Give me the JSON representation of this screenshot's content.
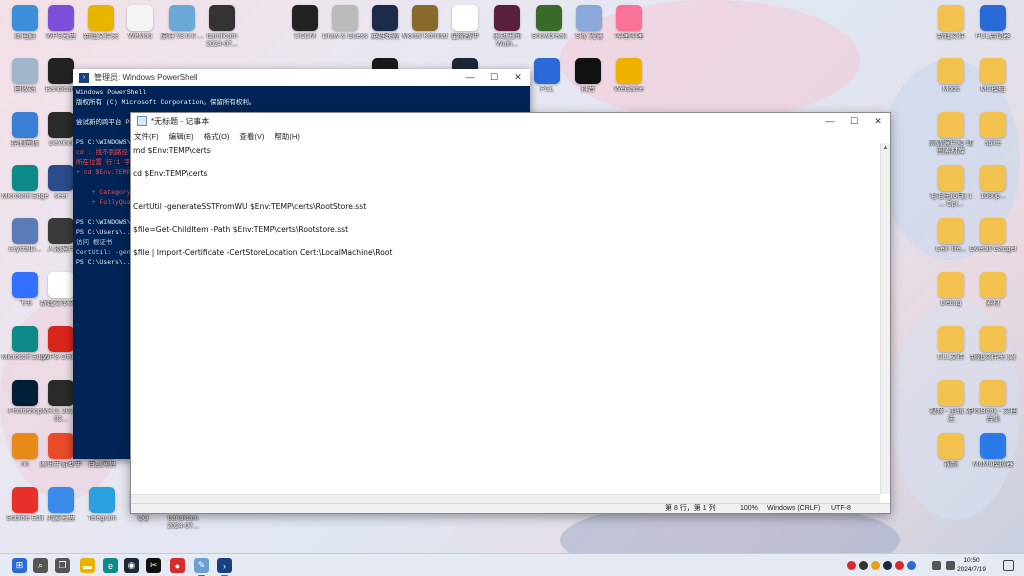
{
  "desktop_icons": [
    {
      "id": "i1",
      "label": "此电脑",
      "icon": "computer-icon",
      "color": "#3b8ed8"
    },
    {
      "id": "i2",
      "label": "WPS云盘",
      "icon": "wps-cloud-icon",
      "color": "#7b4fd8"
    },
    {
      "id": "i3",
      "label": "新建文件夹",
      "icon": "app-yellow-icon",
      "color": "#e8b400"
    },
    {
      "id": "i4",
      "label": "WeMod",
      "icon": "wemod-icon",
      "color": "#f4f4f4"
    },
    {
      "id": "i5",
      "label": "原神 v3.0.0 ...",
      "icon": "app-icon",
      "color": "#6aa8d8"
    },
    {
      "id": "i6",
      "label": "bandicam 2024-07...",
      "icon": "video-file-icon",
      "color": "#333333"
    },
    {
      "id": "i7",
      "label": "CODM",
      "icon": "game-icon",
      "color": "#222222"
    },
    {
      "id": "i8",
      "label": "Draw & Guess",
      "icon": "pencil-icon",
      "color": "#bbbbbb"
    },
    {
      "id": "i9",
      "label": "英雄联盟",
      "icon": "lol-icon",
      "color": "#1c2b4a"
    },
    {
      "id": "i10",
      "label": "Mortal Kombat",
      "icon": "game-icon",
      "color": "#8a6a2a"
    },
    {
      "id": "i11",
      "label": "星际战甲",
      "icon": "warframe-icon",
      "color": "#ffffff"
    },
    {
      "id": "i12",
      "label": "永劫无间 Wuth...",
      "icon": "game-icon",
      "color": "#5a1f3a"
    },
    {
      "id": "i13",
      "label": "Snowbreak",
      "icon": "game-icon",
      "color": "#3a6a2a"
    },
    {
      "id": "i14",
      "label": "Sky 光遇",
      "icon": "sky-icon",
      "color": "#8aa8d8"
    },
    {
      "id": "i15",
      "label": "哔哩哔哩",
      "icon": "bilibili-icon",
      "color": "#fb7299"
    },
    {
      "id": "i16",
      "label": "回收站",
      "icon": "recycle-bin-icon",
      "color": "#9fb6cc"
    },
    {
      "id": "i17",
      "label": "Bandicam",
      "icon": "record-icon",
      "color": "#222222"
    },
    {
      "id": "i18",
      "label": "控制面板",
      "icon": "control-panel-icon",
      "color": "#3b7ed8"
    },
    {
      "id": "i19",
      "label": "DaVinci",
      "icon": "davinci-icon",
      "color": "#2a2a2a"
    },
    {
      "id": "i20",
      "label": "Microsoft Edge",
      "icon": "edge-icon",
      "color": "#0c8a8a"
    },
    {
      "id": "i21",
      "label": "seer",
      "icon": "app-icon",
      "color": "#2b4b8a"
    },
    {
      "id": "i22",
      "label": "CrystalD...",
      "icon": "app-icon",
      "color": "#5a7ab8"
    },
    {
      "id": "i23",
      "label": "人物照片",
      "icon": "photo-icon",
      "color": "#3a3a3a"
    },
    {
      "id": "i24",
      "label": "飞书",
      "icon": "lark-icon",
      "color": "#3370ff"
    },
    {
      "id": "i25",
      "label": "新建文本文档",
      "icon": "text-file-icon",
      "color": "#ffffff"
    },
    {
      "id": "i26",
      "label": "Microsoft Edge",
      "icon": "edge-icon",
      "color": "#0c8a8a"
    },
    {
      "id": "i27",
      "label": "WPS Office",
      "icon": "wps-icon",
      "color": "#d8251b"
    },
    {
      "id": "i28",
      "label": "Photoshop",
      "icon": "ps-icon",
      "color": "#001e36"
    },
    {
      "id": "i29",
      "label": "MK11 2024-02...",
      "icon": "video-file-icon",
      "color": "#2a2a2a"
    },
    {
      "id": "i30",
      "label": "nn",
      "icon": "app-icon",
      "color": "#e88a1a"
    },
    {
      "id": "i31",
      "label": "腾讯手游助手",
      "icon": "app-icon",
      "color": "#e84a2a"
    },
    {
      "id": "i32",
      "label": "百度网盘",
      "icon": "baidu-icon",
      "color": "#2b73e8"
    },
    {
      "id": "i33",
      "label": "Subtitle Edit",
      "icon": "subtitle-edit-icon",
      "color": "#e8302a"
    },
    {
      "id": "i34",
      "label": "鸿蒙云盘",
      "icon": "app-icon",
      "color": "#3a8ae8"
    },
    {
      "id": "i35",
      "label": "Telegram",
      "icon": "telegram-icon",
      "color": "#2aa0e0"
    },
    {
      "id": "i36",
      "label": "QQ",
      "icon": "qq-icon",
      "color": "#4aa0e8"
    },
    {
      "id": "i37",
      "label": "bandicam 2024-07...",
      "icon": "video-file-icon",
      "color": "#3a3a3a"
    },
    {
      "id": "i38",
      "label": "Epic",
      "icon": "epic-icon",
      "color": "#1a1a1a"
    },
    {
      "id": "i39",
      "label": "Steam",
      "icon": "steam-icon",
      "color": "#1b2838"
    },
    {
      "id": "i40",
      "label": "PCL",
      "icon": "pcl-icon",
      "color": "#2a6ad8"
    },
    {
      "id": "i41",
      "label": "抖音",
      "icon": "tiktok-icon",
      "color": "#111111"
    },
    {
      "id": "i42",
      "label": "WeGame",
      "icon": "wegame-icon",
      "color": "#f0b000"
    },
    {
      "id": "i43",
      "label": "Plain Craft Launche...",
      "icon": "app-icon",
      "color": "#2a6ad8"
    },
    {
      "id": "i44",
      "label": "新建文件",
      "icon": "folder-icon",
      "color": "#f2c14e"
    },
    {
      "id": "i45",
      "label": "PCL启动器",
      "icon": "pcl-icon",
      "color": "#2a6ad8"
    },
    {
      "id": "i46",
      "label": "Mods",
      "icon": "folder-icon",
      "color": "#f2c14e"
    },
    {
      "id": "i47",
      "label": "MC模组",
      "icon": "folder-icon",
      "color": "#f2c14e"
    },
    {
      "id": "i48",
      "label": "高清照片和 动图素材库",
      "icon": "folder-icon",
      "color": "#f2c14e"
    },
    {
      "id": "i49",
      "label": "spice",
      "icon": "folder-icon",
      "color": "#f2c14e"
    },
    {
      "id": "i50",
      "label": "毛毛虫(6月) 1 ... Opt...",
      "icon": "folder-icon",
      "color": "#f2c14e"
    },
    {
      "id": "i51",
      "label": "1080p...",
      "icon": "folder-icon",
      "color": "#f2c14e"
    },
    {
      "id": "i52",
      "label": "Cell- life...",
      "icon": "folder-icon",
      "color": "#f2c14e"
    },
    {
      "id": "i53",
      "label": "Overall Gadget",
      "icon": "folder-icon",
      "color": "#f2c14e"
    },
    {
      "id": "i54",
      "label": "Debug",
      "icon": "folder-icon",
      "color": "#f2c14e"
    },
    {
      "id": "i55",
      "label": "素材",
      "icon": "folder-icon",
      "color": "#f2c14e"
    },
    {
      "id": "i56",
      "label": "DLL文件",
      "icon": "folder-icon",
      "color": "#f2c14e"
    },
    {
      "id": "i57",
      "label": "新建文件夹 (2)",
      "icon": "folder-icon",
      "color": "#f2c14e"
    },
    {
      "id": "i58",
      "label": "视频 - 剪辑 方法",
      "icon": "folder-icon",
      "color": "#f2c14e"
    },
    {
      "id": "i59",
      "label": "PlotBook - 文档合集",
      "icon": "folder-icon",
      "color": "#f2c14e"
    },
    {
      "id": "i60",
      "label": "视频",
      "icon": "image-icon",
      "color": "#f2c14e"
    },
    {
      "id": "i61",
      "label": "MuMu模拟器",
      "icon": "mumu-icon",
      "color": "#2a7ae8"
    }
  ],
  "powershell": {
    "title": "管理员: Windows PowerShell",
    "lines": [
      {
        "text": "Windows PowerShell",
        "cls": ""
      },
      {
        "text": "版权所有 (C) Microsoft Corporation。保留所有权利。",
        "cls": ""
      },
      {
        "text": "",
        "cls": ""
      },
      {
        "text": "尝试新的跨平台 PowerShell https://aka.ms/pscore6",
        "cls": ""
      },
      {
        "text": "",
        "cls": ""
      },
      {
        "text": "PS C:\\WINDOWS\\system32> cd $Env:TEMP\\certs",
        "cls": ""
      },
      {
        "text": "cd : 找不到路径\"C:\\Users\\...\\certs\"，因为该路径不存在。",
        "cls": "red"
      },
      {
        "text": "所在位置 行:1 字符: 1",
        "cls": "red"
      },
      {
        "text": "+ cd $Env:TEMP\\certs",
        "cls": "red"
      },
      {
        "text": "",
        "cls": ""
      },
      {
        "text": "    + CategoryInfo          : ObjectNotFound",
        "cls": "red"
      },
      {
        "text": "    + FullyQualifiedErrorId : PathNotFound",
        "cls": "red"
      },
      {
        "text": "",
        "cls": ""
      },
      {
        "text": "PS C:\\WINDOWS\\system32> md $Env:TEMP\\certs",
        "cls": ""
      },
      {
        "text": "PS C:\\Users\\...> CertUtil -generateSSTFromWU",
        "cls": ""
      },
      {
        "text": "访问 根证书",
        "cls": "gray"
      },
      {
        "text": "CertUtil: -generateSSTFromWU",
        "cls": "gray"
      },
      {
        "text": "PS C:\\Users\\...>",
        "cls": ""
      }
    ]
  },
  "notepad": {
    "title": "*无标题 - 记事本",
    "menu": [
      "文件(F)",
      "编辑(E)",
      "格式(O)",
      "查看(V)",
      "帮助(H)"
    ],
    "lines": [
      "md $Env:TEMP\\certs",
      "",
      "cd $Env:TEMP\\certs",
      "",
      "",
      "CertUtil -generateSSTFromWU $Env:TEMP\\certs\\RootStore.sst",
      "",
      "$file=Get-ChildItem -Path $Env:TEMP\\certs\\Rootstore.sst",
      "",
      "$file | Import-Certificate -CertStoreLocation Cert:\\LocalMachine\\Root"
    ],
    "status": {
      "position": "第 8 行，第 1 列",
      "zoom": "100%",
      "line_ending": "Windows (CRLF)",
      "encoding": "UTF-8"
    }
  },
  "window_controls": {
    "minimize": "—",
    "maximize": "☐",
    "close": "✕"
  },
  "taskbar": {
    "items": [
      {
        "id": "start",
        "icon": "windows-start-icon",
        "color": "#2a6ad8",
        "glyph": "⊞"
      },
      {
        "id": "search",
        "icon": "search-icon",
        "color": "#555555",
        "glyph": "⌕"
      },
      {
        "id": "taskview",
        "icon": "task-view-icon",
        "color": "#555555",
        "glyph": "❐"
      },
      {
        "id": "explorer",
        "icon": "file-explorer-icon",
        "color": "#e8b400",
        "glyph": "▬"
      },
      {
        "id": "edge",
        "icon": "edge-icon",
        "color": "#0c8a8a",
        "glyph": "e"
      },
      {
        "id": "steam",
        "icon": "steam-icon",
        "color": "#1b2838",
        "glyph": "◉"
      },
      {
        "id": "capcut",
        "icon": "capcut-icon",
        "color": "#111111",
        "glyph": "✂"
      },
      {
        "id": "bandicam",
        "icon": "record-icon",
        "color": "#d82a2a",
        "glyph": "●"
      },
      {
        "id": "notepad",
        "icon": "notepad-icon",
        "color": "#6aa0d0",
        "glyph": "✎"
      },
      {
        "id": "powershell",
        "icon": "powershell-icon",
        "color": "#1a3f83",
        "glyph": "›"
      }
    ],
    "clock_time": "10:50",
    "clock_date": "2024/7/19"
  }
}
